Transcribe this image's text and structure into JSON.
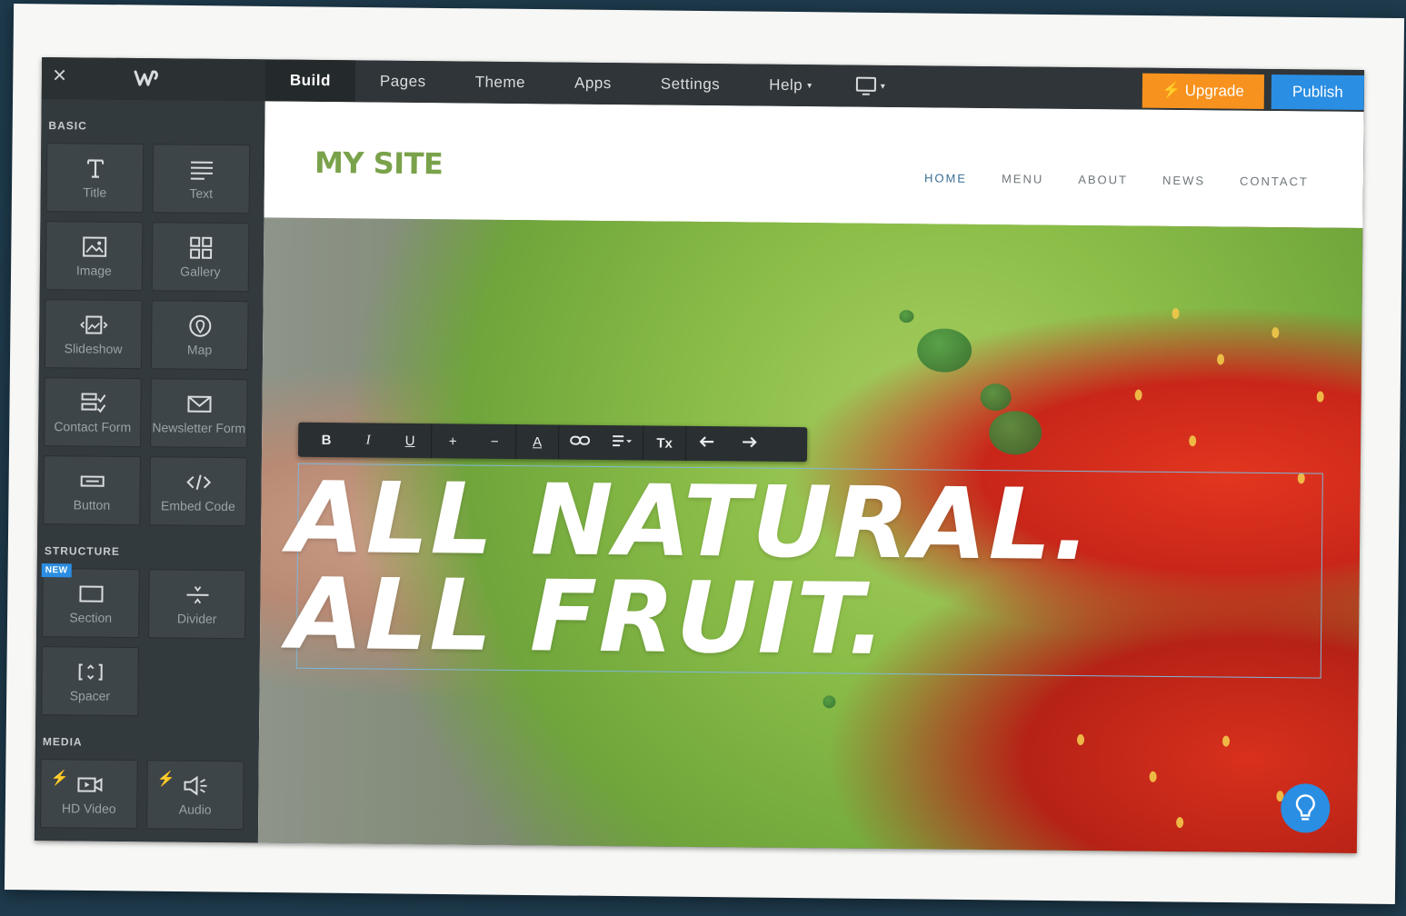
{
  "topbar": {
    "tabs": [
      {
        "label": "Build"
      },
      {
        "label": "Pages"
      },
      {
        "label": "Theme"
      },
      {
        "label": "Apps"
      },
      {
        "label": "Settings"
      },
      {
        "label": "Help"
      }
    ],
    "upgrade_label": "Upgrade",
    "publish_label": "Publish"
  },
  "sidebar": {
    "basic_label": "BASIC",
    "basic_items": [
      "Title",
      "Text",
      "Image",
      "Gallery",
      "Slideshow",
      "Map",
      "Contact Form",
      "Newsletter Form",
      "Button",
      "Embed Code"
    ],
    "structure_label": "STRUCTURE",
    "new_badge": "NEW",
    "structure_items": [
      "Section",
      "Divider",
      "Spacer"
    ],
    "media_label": "MEDIA",
    "media_items": [
      "HD Video",
      "Audio"
    ]
  },
  "site": {
    "title": "MY SITE",
    "nav": [
      "HOME",
      "MENU",
      "ABOUT",
      "NEWS",
      "CONTACT"
    ],
    "headline_line1": "ALL NATURAL.",
    "headline_line2": "ALL FRUIT."
  },
  "toolbar": {
    "bold": "B",
    "italic": "I",
    "underline": "U",
    "plus": "+",
    "minus": "−",
    "font_color": "A",
    "clear_format": "Tx"
  },
  "colors": {
    "upgrade": "#f7921e",
    "publish": "#2a8ee3",
    "site_title": "#7aa24a",
    "nav_active": "#3a6f96"
  }
}
